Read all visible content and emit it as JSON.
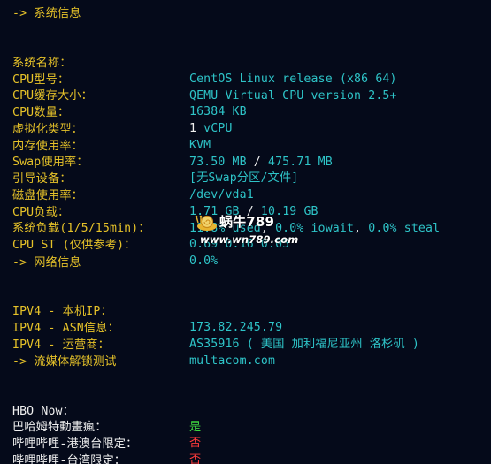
{
  "sections": {
    "system_header": "-> 系统信息",
    "network_header": "-> 网络信息",
    "streaming_header": "-> 流媒体解锁测试"
  },
  "system": {
    "name": {
      "label": "系统名称：",
      "value": "CentOS Linux release (x86 64)"
    },
    "cpu_model": {
      "label": "CPU型号：",
      "value": "QEMU Virtual CPU version 2.5+"
    },
    "cpu_cache": {
      "label": "CPU缓存大小：",
      "value": "16384 KB"
    },
    "cpu_count": {
      "label": "CPU数量：",
      "value_num": "1",
      "value_unit": " vCPU"
    },
    "virt_type": {
      "label": "虚拟化类型：",
      "value": "KVM"
    },
    "memory": {
      "label": "内存使用率：",
      "used": "73.50 MB",
      "sep": " / ",
      "total": "475.71 MB"
    },
    "swap": {
      "label": "Swap使用率：",
      "value": "[无Swap分区/文件]"
    },
    "boot_device": {
      "label": "引导设备：",
      "value": "/dev/vda1"
    },
    "disk": {
      "label": "磁盘使用率：",
      "used": "1.71 GB",
      "sep": " / ",
      "total": "10.19 GB"
    },
    "cpu_load": {
      "label": "CPU负载：",
      "used": "11.8% used",
      "sep1": ", ",
      "iowait": "0.0% iowait",
      "sep2": ", ",
      "steal": "0.0% steal"
    },
    "system_load": {
      "label": "系统负载(1/5/15min)：",
      "value": "0.69 0.16 0.05"
    },
    "cpu_st": {
      "label": "CPU ST (仅供参考)：",
      "value": "0.0%"
    }
  },
  "network": {
    "ipv4_ip": {
      "label": "IPV4 - 本机IP：",
      "value": "173.82.245.79"
    },
    "ipv4_asn": {
      "label": "IPV4 - ASN信息：",
      "value": "AS35916 ( 美国 加利福尼亚州 洛杉矶 )"
    },
    "ipv4_isp": {
      "label": "IPV4 - 运营商：",
      "value": "multacom.com"
    }
  },
  "streaming": {
    "hbo": {
      "label": "HBO Now：",
      "value": "是"
    },
    "bahamut": {
      "label": "巴哈姆特動畫瘋：",
      "value": "否"
    },
    "bili_hk": {
      "label": "哔哩哔哩-港澳台限定：",
      "value": "否"
    },
    "bili_tw": {
      "label": "哔哩哔哩-台湾限定：",
      "value": "否"
    }
  },
  "watermark": {
    "title": "蜗牛789",
    "url": "www.wn789.com"
  },
  "colors": {
    "background": "#050a1a",
    "label_yellow": "#e6c229",
    "value_cyan": "#2ec4c8",
    "text_white": "#f0f0f0",
    "yes_green": "#3fd43f",
    "no_red": "#ff3b3b"
  }
}
